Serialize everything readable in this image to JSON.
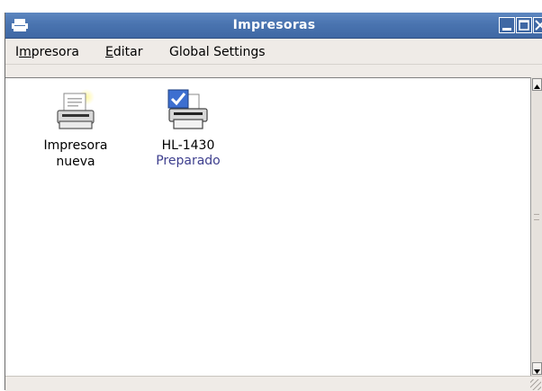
{
  "window": {
    "title": "Impresoras"
  },
  "menubar": {
    "items": [
      {
        "label": "Impresora",
        "mnemonic_index": 1
      },
      {
        "label": "Editar",
        "mnemonic_index": 0
      },
      {
        "label": "Global Settings"
      }
    ]
  },
  "printers": [
    {
      "name_line1": "Impresora",
      "name_line2": "nueva",
      "status": "",
      "icon": "new-printer-icon"
    },
    {
      "name_line1": "HL-1430",
      "name_line2": "",
      "status": "Preparado",
      "icon": "default-printer-icon"
    }
  ],
  "colors": {
    "titlebar": "#4a74b0",
    "status_text": "#3e3f8e",
    "window_bg": "#efebe7"
  }
}
